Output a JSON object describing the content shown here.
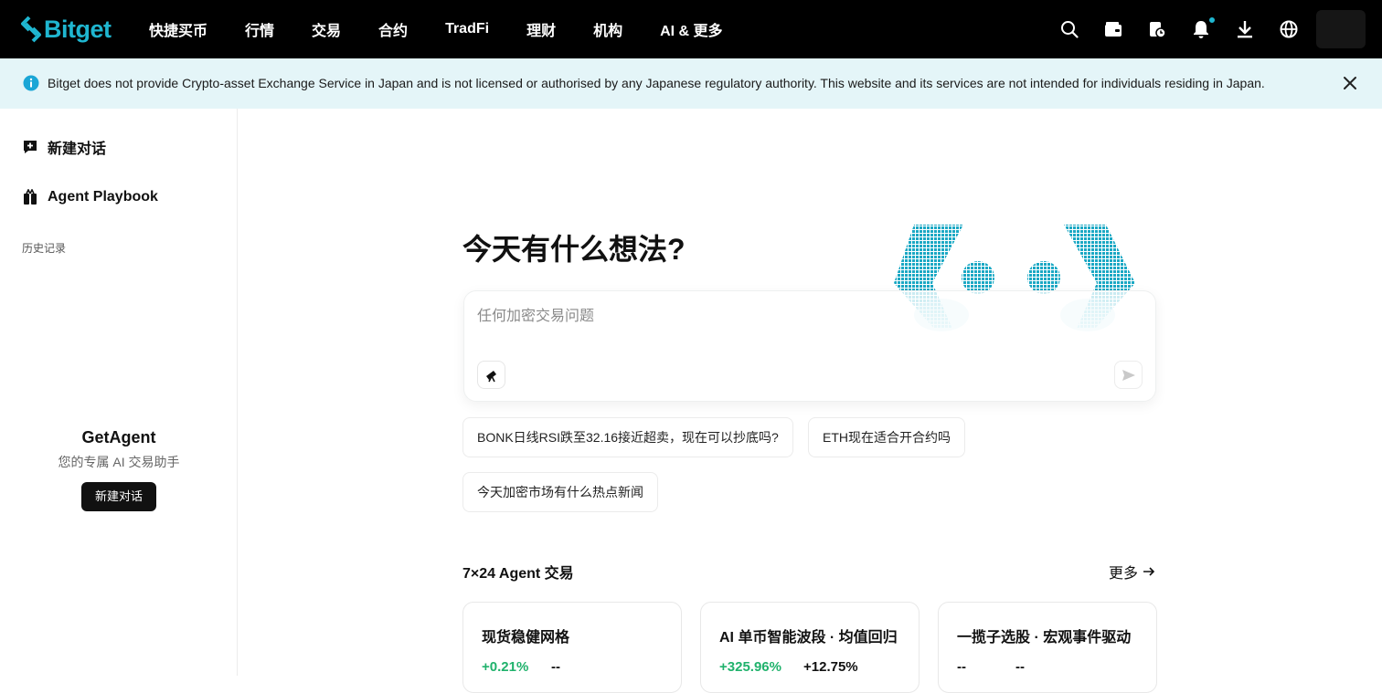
{
  "header": {
    "brand": "Bitget",
    "nav": [
      "快捷买币",
      "行情",
      "交易",
      "合约",
      "TradFi",
      "理财",
      "机构",
      "AI & 更多"
    ],
    "icons": [
      "search-icon",
      "wallet-icon",
      "orders-icon",
      "bell-icon",
      "download-icon",
      "globe-icon"
    ],
    "notification_dot_color": "#1fb6d0"
  },
  "notice": {
    "text": "Bitget does not provide Crypto-asset Exchange Service in Japan and is not licensed or authorised by any Japanese regulatory authority. This website and its services are not intended for individuals residing in Japan."
  },
  "sidebar": {
    "new_chat": "新建对话",
    "playbook": "Agent Playbook",
    "history_label": "历史记录",
    "empty_title": "GetAgent",
    "empty_subtitle": "您的专属 AI 交易助手",
    "empty_button": "新建对话"
  },
  "main": {
    "headline": "今天有什么想法?",
    "prompt_placeholder": "任何加密交易问题",
    "suggestions": [
      "BONK日线RSI跌至32.16接近超卖，现在可以抄底吗?",
      "ETH现在适合开合约吗",
      "今天加密市场有什么热点新闻"
    ],
    "section_title": "7×24 Agent 交易",
    "more_label": "更多",
    "cards": [
      {
        "title": "现货稳健网格",
        "metric1": "+0.21%",
        "metric2": "--"
      },
      {
        "title": "AI 单币智能波段 · 均值回归",
        "metric1": "+325.96%",
        "metric2": "+12.75%"
      },
      {
        "title": "一揽子选股 · 宏观事件驱动",
        "metric1": "--",
        "metric2": "--"
      }
    ]
  },
  "colors": {
    "brand": "#1fb6d0",
    "positive": "#20b26c",
    "notice_bg": "#e4f5f8"
  }
}
